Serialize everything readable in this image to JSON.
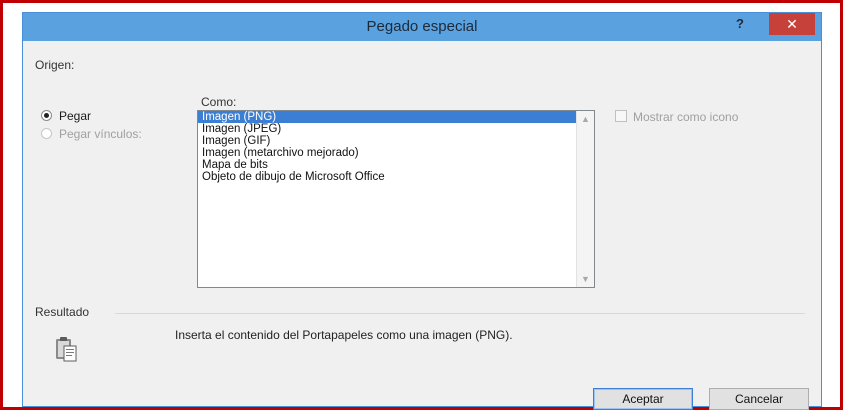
{
  "dialog": {
    "title": "Pegado especial",
    "help_label": "?",
    "close_label": "✕"
  },
  "source": {
    "label": "Origen:"
  },
  "paste_options": [
    {
      "label": "Pegar",
      "checked": true,
      "enabled": true
    },
    {
      "label": "Pegar vínculos:",
      "checked": false,
      "enabled": false
    }
  ],
  "como": {
    "label": "Como:",
    "items": [
      "Imagen (PNG)",
      "Imagen (JPEG)",
      "Imagen (GIF)",
      "Imagen (metarchivo mejorado)",
      "Mapa de bits",
      "Objeto de dibujo de Microsoft Office"
    ],
    "selected_index": 0
  },
  "show_as_icon": {
    "label": "Mostrar como icono",
    "checked": false,
    "enabled": false
  },
  "result": {
    "label": "Resultado",
    "icon": "clipboard-paste-icon",
    "text": "Inserta el contenido del Portapapeles como una imagen (PNG)."
  },
  "buttons": {
    "ok": "Aceptar",
    "cancel": "Cancelar"
  },
  "colors": {
    "titlebar": "#5aa1df",
    "close_button": "#c7413b",
    "selection": "#3b7fd4",
    "outer_border": "#c00000"
  }
}
